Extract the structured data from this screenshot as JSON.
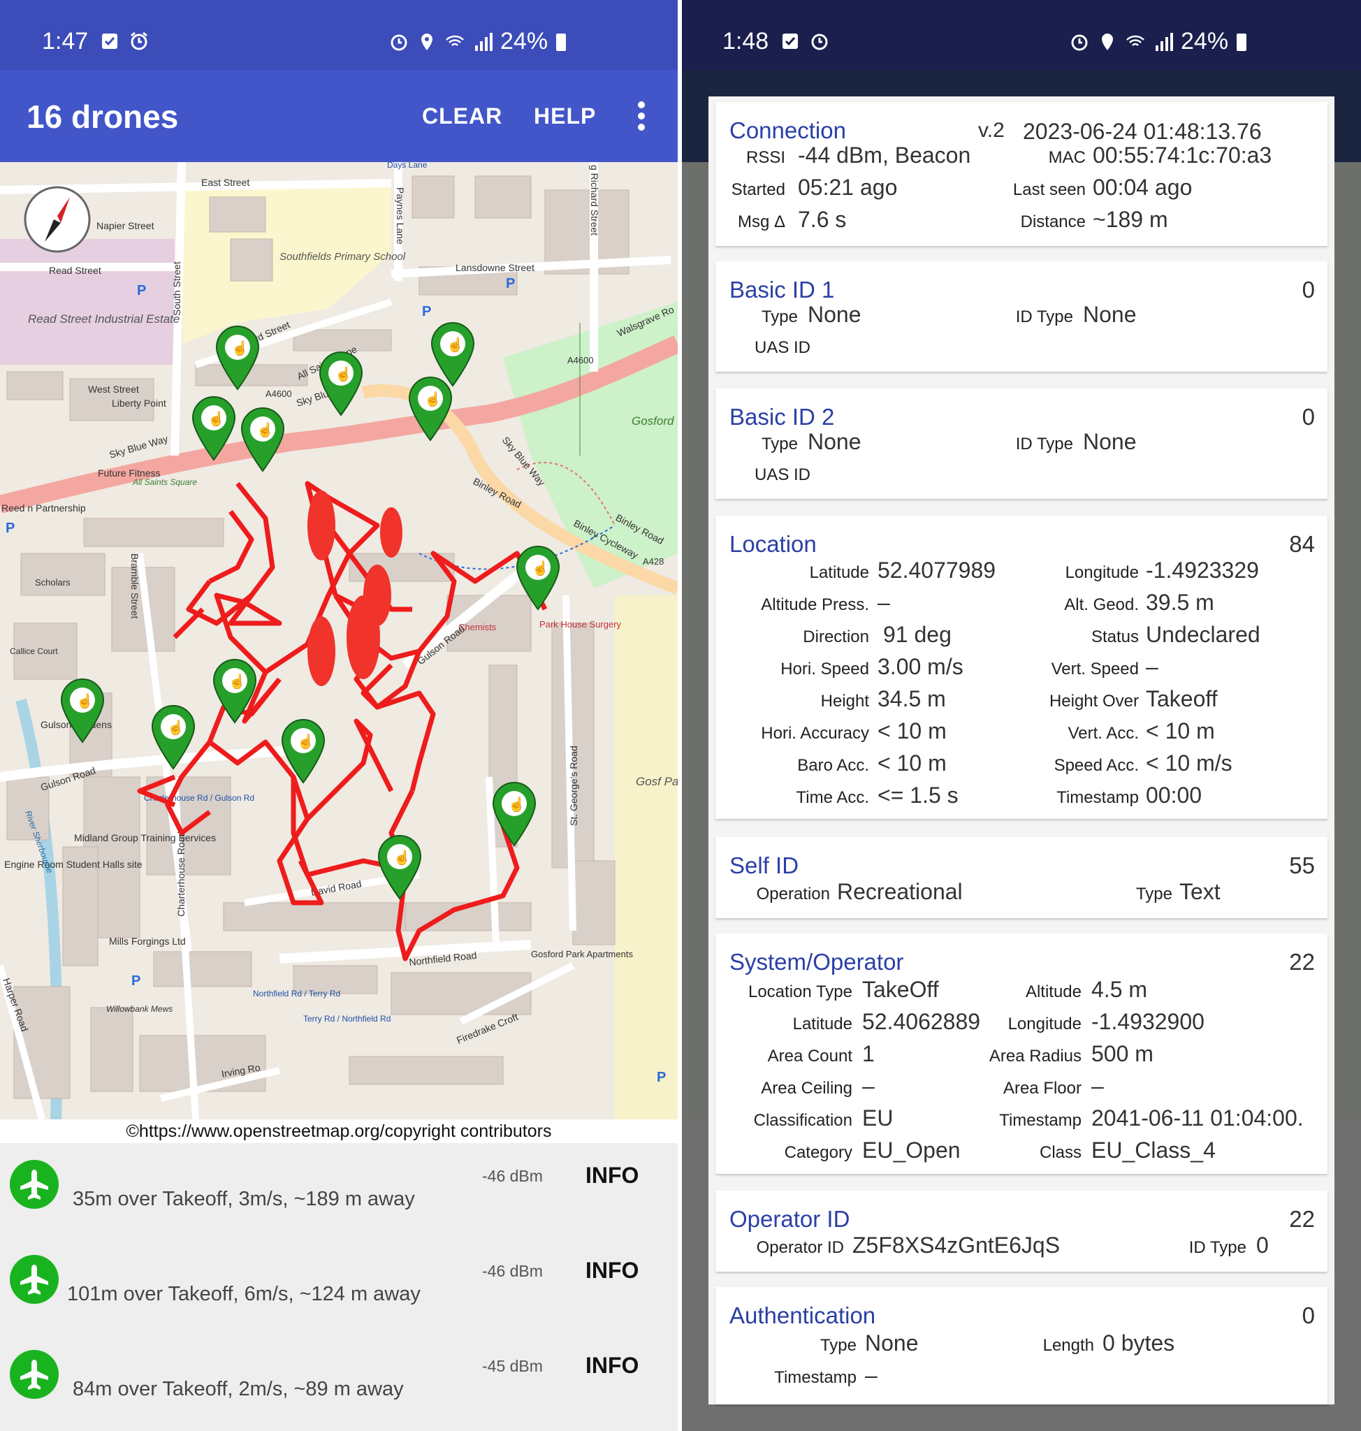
{
  "left_screen": {
    "status_bar": {
      "time": "1:47",
      "battery": "24%"
    },
    "app_bar": {
      "title": "16 drones",
      "clear_label": "CLEAR",
      "help_label": "HELP"
    },
    "map": {
      "attribution": "©https://www.openstreetmap.org/copyright contributors",
      "zoom_out_label": "−",
      "zoom_in_label": "+",
      "labels": {
        "east_street": "East Street",
        "napier_street": "Napier Street",
        "read_street": "Read Street",
        "read_street_estate": "Read Street Industrial Estate",
        "southfields_school": "Southfields Primary School",
        "lansdowne_street": "Lansdowne Street",
        "oxford_street": "Oxford Street",
        "all_saints_lane": "All Saints Lane",
        "walsgrave_road": "Walsgrave Ro",
        "a4600_east": "A4600",
        "a4600_west": "A4600",
        "west_street": "West Street",
        "liberty_point": "Liberty Point",
        "sky_blue_way_1": "Sky Blue Way",
        "sky_blue_way_2": "Sky Blue Way",
        "sky_blue_way_3": "Sky Blue Way",
        "future_fitness": "Future Fitness",
        "all_saints_square": "All Saints Square",
        "gosford_park": "Gosford Park",
        "binley_road": "Binley Road",
        "binley_cycleway": "Binley Cycleway",
        "binley_road_2": "Binley Road",
        "a428": "A428",
        "park_house_surgery": "Park House Surgery",
        "chemists": "Chemists",
        "gulson_road_1": "Gulson Road",
        "gulson_road_2": "Gulson Road",
        "gulson_gardens": "Gulson Gardens",
        "midland_group": "Midland Group Training Services",
        "engine_room": "Engine Room Student Halls site",
        "mills_forgings": "Mills Forgings Ltd",
        "david_road": "David Road",
        "northfield_road": "Northfield Road",
        "firedrake_croft": "Firedrake Croft",
        "irving_road": "Irving Ro",
        "harper_road": "Harper Road",
        "gosford_park_school": "Gosf Park Pr Sch",
        "gosford_park_apartments": "Gosford Park Apartments",
        "st_georges_road": "St. George's Road",
        "charterhouse_road": "Charterhouse Road",
        "bramble_street": "Bramble Street",
        "south_street": "South Street",
        "paynes_lane": "Paynes Lane",
        "days_lane": "Days Lane",
        "richard_street": "g Richard Street",
        "scholars": "Scholars",
        "reed_partnership": "Reed n Partnership",
        "callice_court": "Callice Court",
        "willowbank_mews": "Willowbank Mews",
        "river_sherbourne": "River Sherbourne",
        "charterhouse_stop": "Charterhouse Rd / Gulson Rd",
        "northfield_stop": "Northfield Rd / Terry Rd",
        "terry_stop": "Terry Rd / Northfield Rd"
      }
    },
    "drones": [
      {
        "summary": "35m over Takeoff,   3m/s, ~189 m away",
        "rssi": "-46 dBm",
        "info": "INFO"
      },
      {
        "summary": "101m over Takeoff,   6m/s, ~124 m away",
        "rssi": "-46 dBm",
        "info": "INFO"
      },
      {
        "summary": "84m over Takeoff,   2m/s, ~89 m away",
        "rssi": "-45 dBm",
        "info": "INFO"
      }
    ]
  },
  "right_screen": {
    "status_bar": {
      "time": "1:48",
      "battery": "24%"
    },
    "connection": {
      "title": "Connection",
      "version": "v.2",
      "timestamp": "2023-06-24 01:48:13.76",
      "rssi_label": "RSSI",
      "rssi": "-44 dBm, Beacon",
      "mac_label": "MAC",
      "mac": "00:55:74:1c:70:a3",
      "started_label": "Started",
      "started": "05:21  ago",
      "last_seen_label": "Last seen",
      "last_seen": "00:04  ago",
      "msg_label": "Msg Δ",
      "msg": "7.6 s",
      "distance_label": "Distance",
      "distance": "~189 m"
    },
    "basic_id_1": {
      "title": "Basic ID 1",
      "count": "0",
      "type_label": "Type",
      "type": "None",
      "id_type_label": "ID Type",
      "id_type": "None",
      "uas_label": "UAS ID"
    },
    "basic_id_2": {
      "title": "Basic ID 2",
      "count": "0",
      "type_label": "Type",
      "type": "None",
      "id_type_label": "ID Type",
      "id_type": "None",
      "uas_label": "UAS ID"
    },
    "location": {
      "title": "Location",
      "count": "84",
      "latitude_label": "Latitude",
      "latitude": "52.4077989",
      "longitude_label": "Longitude",
      "longitude": "-1.4923329",
      "alt_press_label": "Altitude Press.",
      "alt_press": "–",
      "alt_geod_label": "Alt. Geod.",
      "alt_geod": "39.5 m",
      "direction_label": "Direction",
      "direction": "91 deg",
      "status_label": "Status",
      "status": "Undeclared",
      "hori_speed_label": "Hori. Speed",
      "hori_speed": "3.00 m/s",
      "vert_speed_label": "Vert. Speed",
      "vert_speed": "–",
      "height_label": "Height",
      "height": "34.5 m",
      "height_over_label": "Height Over",
      "height_over": "Takeoff",
      "hori_acc_label": "Hori. Accuracy",
      "hori_acc": "< 10 m",
      "vert_acc_label": "Vert. Acc.",
      "vert_acc": "< 10 m",
      "baro_acc_label": "Baro Acc.",
      "baro_acc": "< 10 m",
      "speed_acc_label": "Speed Acc.",
      "speed_acc": "< 10 m/s",
      "time_acc_label": "Time Acc.",
      "time_acc": "<= 1.5 s",
      "timestamp_label": "Timestamp",
      "timestamp": "00:00"
    },
    "self_id": {
      "title": "Self ID",
      "count": "55",
      "operation_label": "Operation",
      "operation": "Recreational",
      "type_label": "Type",
      "type": "Text"
    },
    "system": {
      "title": "System/Operator",
      "count": "22",
      "location_type_label": "Location Type",
      "location_type": "TakeOff",
      "altitude_label": "Altitude",
      "altitude": "4.5 m",
      "latitude_label": "Latitude",
      "latitude": "52.4062889",
      "longitude_label": "Longitude",
      "longitude": "-1.4932900",
      "area_count_label": "Area Count",
      "area_count": "1",
      "area_radius_label": "Area Radius",
      "area_radius": "500 m",
      "area_ceiling_label": "Area Ceiling",
      "area_ceiling": "–",
      "area_floor_label": "Area Floor",
      "area_floor": "–",
      "classification_label": "Classification",
      "classification": "EU",
      "timestamp_label": "Timestamp",
      "timestamp": "2041-06-11 01:04:00.",
      "category_label": "Category",
      "category": "EU_Open",
      "class_label": "Class",
      "class": "EU_Class_4"
    },
    "operator_id": {
      "title": "Operator ID",
      "count": "22",
      "operator_id_label": "Operator ID",
      "operator_id": "Z5F8XS4zGntE6JqS",
      "id_type_label": "ID Type",
      "id_type": "0"
    },
    "authentication": {
      "title": "Authentication",
      "count": "0",
      "type_label": "Type",
      "type": "None",
      "length_label": "Length",
      "length": "0 bytes",
      "timestamp_label": "Timestamp",
      "timestamp": "–"
    }
  }
}
